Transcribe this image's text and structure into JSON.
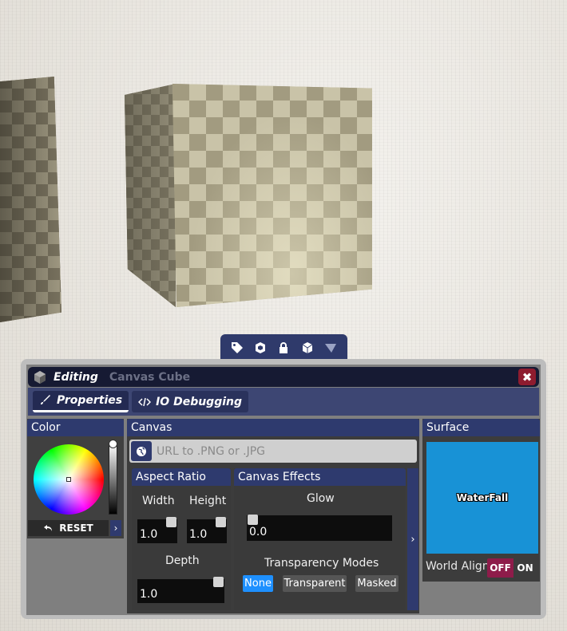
{
  "toolbar": {
    "icons": [
      "tag-icon",
      "shapes-icon",
      "lock-icon",
      "cube-icon",
      "triangle-icon"
    ]
  },
  "window": {
    "editing_label": "Editing",
    "object_name": "Canvas Cube",
    "close_label": "✖"
  },
  "tabs": [
    {
      "label": "Properties",
      "active": true
    },
    {
      "label": "IO Debugging",
      "active": false
    }
  ],
  "color": {
    "header": "Color",
    "reset_label": "RESET",
    "expand_label": "›"
  },
  "canvas": {
    "header": "Canvas",
    "url_placeholder": "URL to .PNG or .JPG",
    "aspect": {
      "header": "Aspect Ratio",
      "width_label": "Width",
      "width_value": "1.0",
      "height_label": "Height",
      "height_value": "1.0",
      "depth_label": "Depth",
      "depth_value": "1.0"
    },
    "effects": {
      "header": "Canvas Effects",
      "glow_label": "Glow",
      "glow_value": "0.0",
      "transparency_label": "Transparency Modes",
      "modes": [
        {
          "label": "None",
          "selected": true
        },
        {
          "label": "Transparent",
          "selected": false
        },
        {
          "label": "Masked",
          "selected": false
        }
      ]
    },
    "expand_label": "›"
  },
  "surface": {
    "header": "Surface",
    "tile_label": "WaterFall",
    "tile_color": "#1892d6",
    "world_align_label": "World Align",
    "toggle_off": "OFF",
    "toggle_on": "ON",
    "world_align_state": "OFF"
  },
  "colors": {
    "accent_blue": "#1e90ff",
    "header_navy": "#2e3a6e",
    "close_red": "#8e1c2f"
  }
}
